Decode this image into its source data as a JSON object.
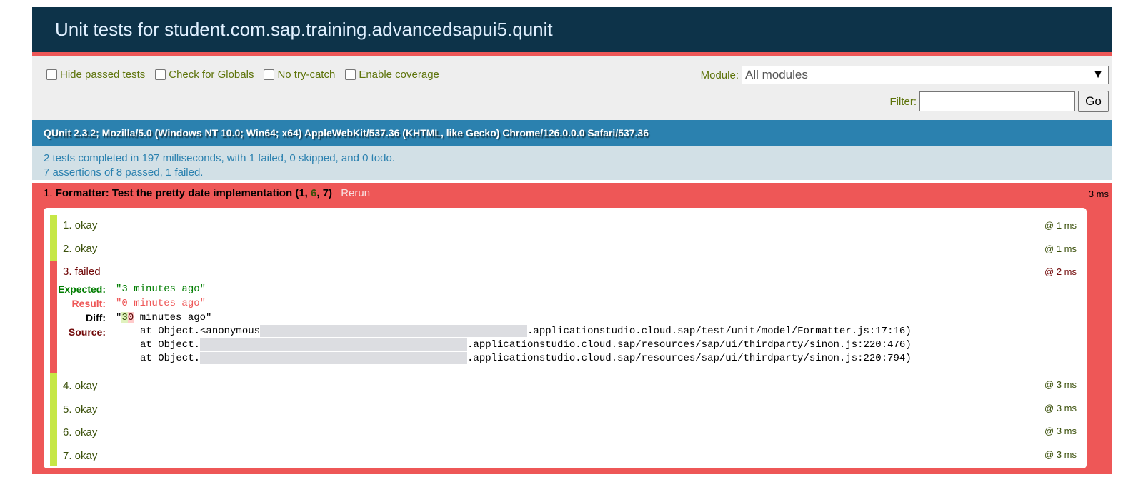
{
  "header": {
    "title": "Unit tests for student.com.sap.training.advancedsapui5.qunit"
  },
  "toolbar": {
    "options": [
      {
        "label": "Hide passed tests"
      },
      {
        "label": "Check for Globals"
      },
      {
        "label": "No try-catch"
      },
      {
        "label": "Enable coverage"
      }
    ],
    "module_label": "Module:",
    "module_value": "All modules",
    "filter_label": "Filter:",
    "filter_value": "",
    "go_label": "Go"
  },
  "user_agent": "QUnit 2.3.2; Mozilla/5.0 (Windows NT 10.0; Win64; x64) AppleWebKit/537.36 (KHTML, like Gecko) Chrome/126.0.0.0 Safari/537.36",
  "summary": {
    "line1": "2 tests completed in 197 milliseconds, with 1 failed, 0 skipped, and 0 todo.",
    "line2": "7 assertions of 8 passed, 1 failed."
  },
  "test": {
    "index": "1.",
    "module": "Formatter:",
    "name": "Test the pretty date implementation",
    "failed": "1",
    "passed": "6",
    "total": "7",
    "rerun": "Rerun",
    "runtime": "3 ms",
    "assertions": [
      {
        "label": "1. okay",
        "time": "@ 1 ms",
        "status": "pass"
      },
      {
        "label": "2. okay",
        "time": "@ 1 ms",
        "status": "pass"
      },
      {
        "label": "3. failed",
        "time": "@ 2 ms",
        "status": "fail"
      },
      {
        "label": "4. okay",
        "time": "@ 3 ms",
        "status": "pass"
      },
      {
        "label": "5. okay",
        "time": "@ 3 ms",
        "status": "pass"
      },
      {
        "label": "6. okay",
        "time": "@ 3 ms",
        "status": "pass"
      },
      {
        "label": "7. okay",
        "time": "@ 3 ms",
        "status": "pass"
      }
    ],
    "failure": {
      "expected_label": "Expected:",
      "expected": "\"3 minutes ago\"",
      "result_label": "Result:",
      "result": "\"0 minutes ago\"",
      "diff_label": "Diff:",
      "diff_prefix": "\"",
      "diff_ins": "3",
      "diff_del": "0",
      "diff_suffix": " minutes ago\"",
      "source_label": "Source:",
      "source": [
        {
          "prefix": "at Object.<anonymous",
          "suffix": ".applicationstudio.cloud.sap/test/unit/model/Formatter.js:17:16)"
        },
        {
          "prefix": "at Object.",
          "suffix": ".applicationstudio.cloud.sap/resources/sap/ui/thirdparty/sinon.js:220:476)"
        },
        {
          "prefix": "at Object.",
          "suffix": ".applicationstudio.cloud.sap/resources/sap/ui/thirdparty/sinon.js:220:794)"
        }
      ]
    }
  },
  "colors": {
    "header_bg": "#0d3349",
    "fail": "#ee5757",
    "pass": "#c6e746",
    "ua_bg": "#2b81af",
    "summary_bg": "#d2e0e6"
  }
}
